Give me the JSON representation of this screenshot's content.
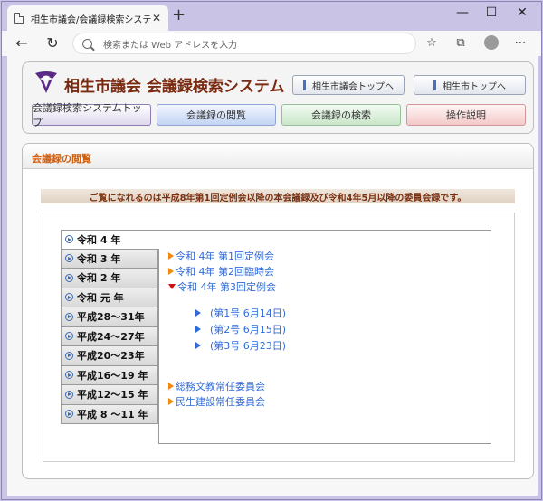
{
  "browser": {
    "tab_title": "相生市議会/会議録検索システム",
    "tab_close": "✕",
    "new_tab": "+",
    "minimize": "—",
    "maximize": "☐",
    "close": "✕",
    "back": "←",
    "reload": "↻",
    "address_placeholder": "検索または Web アドレスを入力",
    "favorites_icon": "☆",
    "collections_icon": "⧉",
    "menu_icon": "⋯"
  },
  "header": {
    "site_title": "相生市議会 会議録検索システム",
    "link_council_top": "相生市議会トップへ",
    "link_city_top": "相生市トップへ",
    "logo_color": "#5b2a86"
  },
  "menu": {
    "items": [
      {
        "label": "会議録検索システムトップ"
      },
      {
        "label": "会議録の閲覧"
      },
      {
        "label": "会議録の検索"
      },
      {
        "label": "操作説明"
      }
    ]
  },
  "content": {
    "section_title": "会議録の閲覧",
    "notice": "ご覧になれるのは平成8年第1回定例会以降の本会議録及び令和4年5月以降の委員会録です。",
    "years": [
      {
        "label": "令和  4 年",
        "active": true
      },
      {
        "label": "令和  3 年",
        "active": false
      },
      {
        "label": "令和  2 年",
        "active": false
      },
      {
        "label": "令和  元 年",
        "active": false
      },
      {
        "label": "平成28～31年",
        "active": false
      },
      {
        "label": "平成24～27年",
        "active": false
      },
      {
        "label": "平成20～23年",
        "active": false
      },
      {
        "label": "平成16～19 年",
        "active": false
      },
      {
        "label": "平成12～15 年",
        "active": false
      },
      {
        "label": "平成  8 ～11 年",
        "active": false
      }
    ],
    "sessions": [
      {
        "label": "令和 4年 第1回定例会",
        "expanded": false
      },
      {
        "label": "令和 4年 第2回臨時会",
        "expanded": false
      },
      {
        "label": "令和 4年 第3回定例会",
        "expanded": true
      }
    ],
    "sub_items": [
      {
        "label": "(第1号 6月14日)"
      },
      {
        "label": "(第2号 6月15日)"
      },
      {
        "label": "(第3号 6月23日)"
      }
    ],
    "committees": [
      {
        "label": "総務文教常任委員会"
      },
      {
        "label": "民生建設常任委員会"
      }
    ]
  },
  "colors": {
    "accent_title": "#7a2a10",
    "link_blue": "#2f6bd8",
    "arrow_orange": "#ee8a10",
    "arrow_red": "#d01010",
    "section_orange": "#d06010"
  }
}
